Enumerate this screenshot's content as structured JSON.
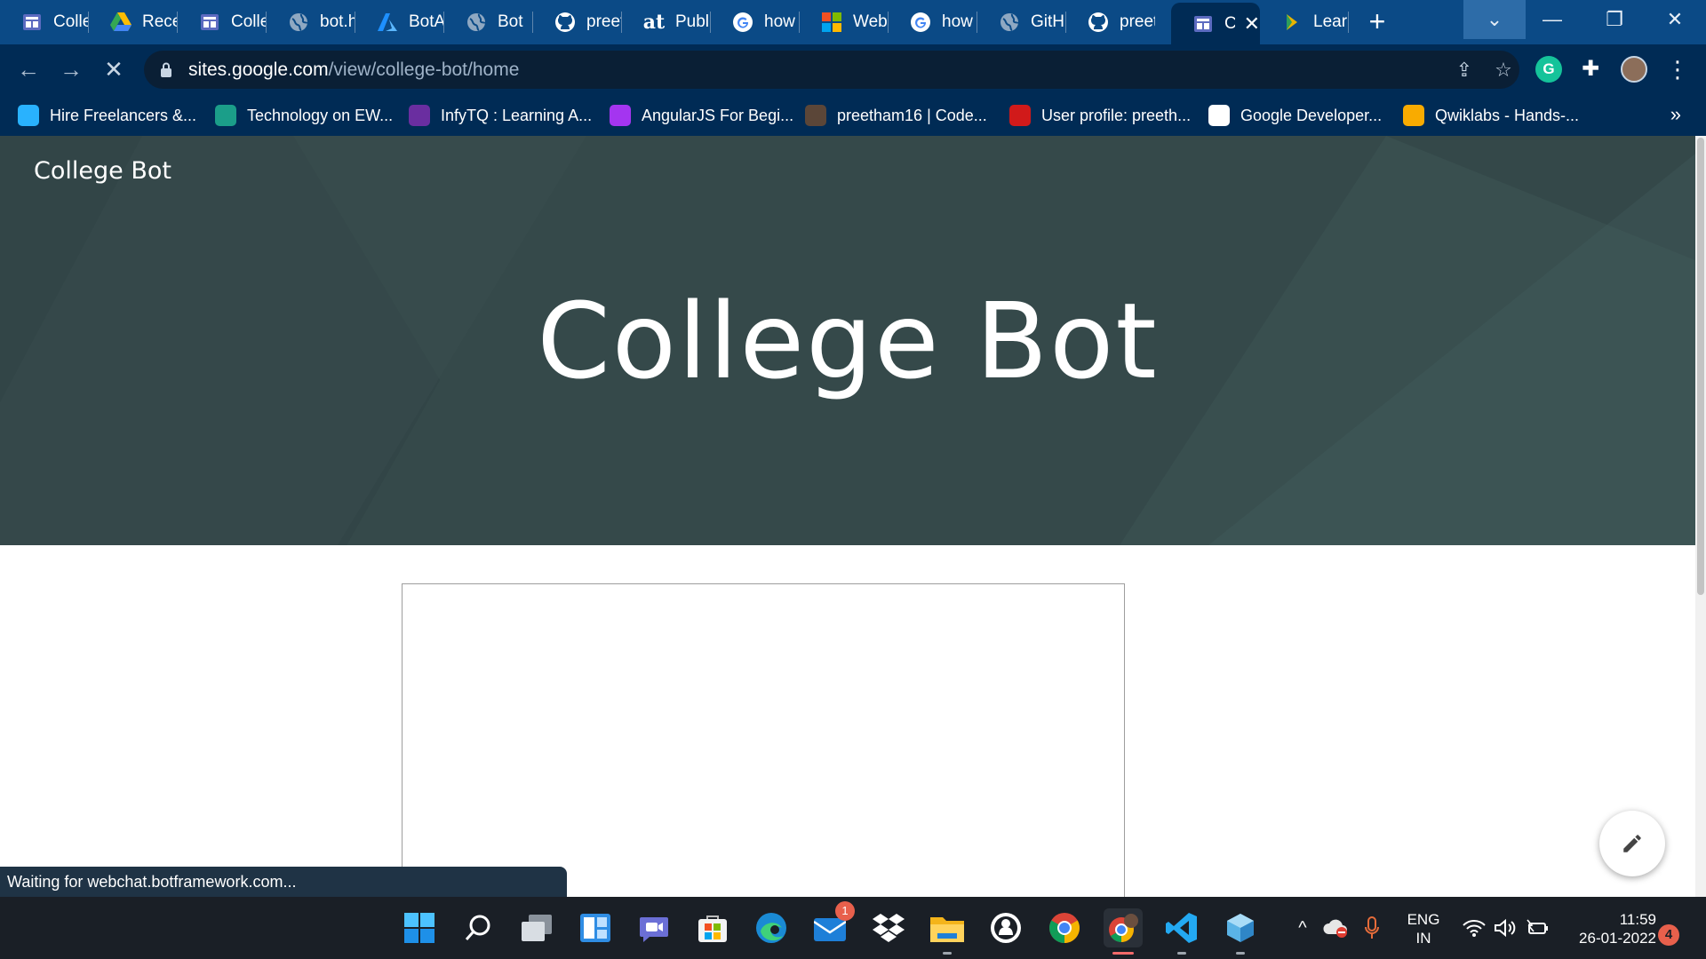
{
  "browser": {
    "tabs": [
      {
        "label": "Colle",
        "icon": "google-sites-icon"
      },
      {
        "label": "Rece",
        "icon": "google-drive-icon"
      },
      {
        "label": "Colle",
        "icon": "google-sites-icon"
      },
      {
        "label": "bot.h",
        "icon": "globe-icon"
      },
      {
        "label": "BotA",
        "icon": "azure-icon"
      },
      {
        "label": "Bot",
        "icon": "globe-icon"
      },
      {
        "label": "preet",
        "icon": "github-icon"
      },
      {
        "label": "Publi",
        "icon": "at-icon"
      },
      {
        "label": "how",
        "icon": "google-icon"
      },
      {
        "label": "Web",
        "icon": "microsoft-icon"
      },
      {
        "label": "how",
        "icon": "google-icon"
      },
      {
        "label": "GitHu",
        "icon": "globe-icon"
      },
      {
        "label": "preet",
        "icon": "github-icon"
      },
      {
        "label": "C",
        "icon": "google-sites-icon",
        "active": true
      },
      {
        "label": "Learn",
        "icon": "learn-icon"
      }
    ],
    "address": {
      "host": "sites.google.com",
      "path": "/view/college-bot/home"
    },
    "bookmarks": [
      {
        "label": "Hire Freelancers &...",
        "icon": "freelancer-icon",
        "color": "#29b2fe"
      },
      {
        "label": "Technology on EW...",
        "icon": "ew-icon",
        "color": "#1b9e89"
      },
      {
        "label": "InfyTQ : Learning A...",
        "icon": "infytq-icon",
        "color": "#6a2ea0"
      },
      {
        "label": "AngularJS For Begi...",
        "icon": "udemy-icon",
        "color": "#a435f0"
      },
      {
        "label": "preetham16 | Code...",
        "icon": "codechef-icon",
        "color": "#5b4638"
      },
      {
        "label": "User profile: preeth...",
        "icon": "spoj-icon",
        "color": "#d11a1a"
      },
      {
        "label": "Google Developer...",
        "icon": "google-developers-icon",
        "color": "#ffffff"
      },
      {
        "label": "Qwiklabs - Hands-...",
        "icon": "qwiklabs-icon",
        "color": "#f9ab00"
      }
    ],
    "bookmarks_more": "»",
    "status_text": "Waiting for webchat.botframework.com..."
  },
  "page": {
    "site_name": "College Bot",
    "hero_title": "College Bot"
  },
  "taskbar": {
    "apps": [
      "start-icon",
      "search-icon",
      "task-view-icon",
      "widgets-icon",
      "teams-chat-icon",
      "microsoft-store-icon",
      "edge-icon",
      "mail-icon",
      "dropbox-icon",
      "file-explorer-icon",
      "github-desktop-icon",
      "chrome-icon",
      "chrome-profile-icon",
      "vscode-icon",
      "virtualbox-icon"
    ],
    "mail_badge": "1",
    "language": {
      "line1": "ENG",
      "line2": "IN"
    },
    "time": "11:59",
    "date": "26-01-2022",
    "notifications": "4"
  }
}
